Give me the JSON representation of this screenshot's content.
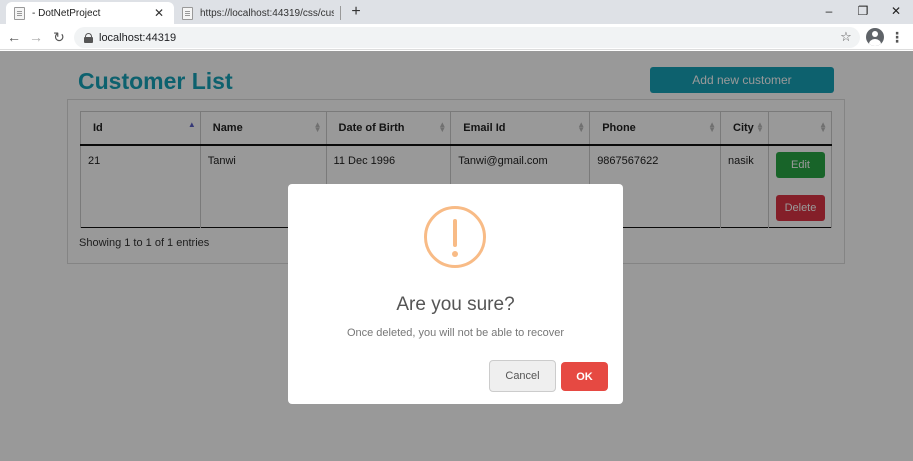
{
  "browser": {
    "tabs": [
      {
        "title": "- DotNetProject",
        "active": true
      },
      {
        "title": "https://localhost:44319/css/custo",
        "active": false
      }
    ],
    "new_tab": "+",
    "url": "localhost:44319",
    "window_controls": {
      "minimize": "–",
      "restore": "❐",
      "close": "✕"
    }
  },
  "page": {
    "title": "Customer List",
    "add_button": "Add new customer",
    "table": {
      "columns": [
        "Id",
        "Name",
        "Date of Birth",
        "Email Id",
        "Phone",
        "City",
        ""
      ],
      "rows": [
        {
          "id": "21",
          "name": "Tanwi",
          "dob": "11 Dec 1996",
          "email": "Tanwi@gmail.com",
          "phone": "9867567622",
          "city": "nasik",
          "edit": "Edit",
          "delete": "Delete"
        }
      ]
    },
    "entries_info": "Showing 1 to 1 of 1 entries"
  },
  "modal": {
    "icon": "warning-icon",
    "title": "Are you sure?",
    "text": "Once deleted, you will not be able to recover",
    "cancel": "Cancel",
    "ok": "OK"
  },
  "colors": {
    "accent": "#17a2b8",
    "edit": "#28a745",
    "delete": "#dc3545",
    "ok": "#e64942",
    "warning": "#f8bb86"
  }
}
